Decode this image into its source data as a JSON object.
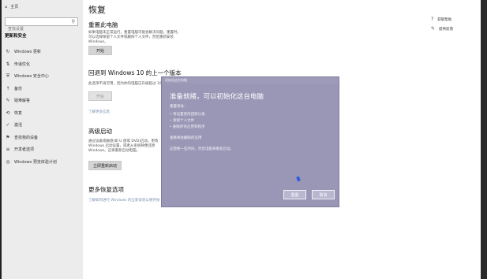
{
  "sidebar": {
    "home_label": "主页",
    "search_placeholder": "查找设置",
    "section_title": "更新和安全",
    "items": [
      {
        "label": "Windows 更新",
        "icon": "sync-icon"
      },
      {
        "label": "传递优化",
        "icon": "delivery-icon"
      },
      {
        "label": "Windows 安全中心",
        "icon": "shield-icon"
      },
      {
        "label": "备份",
        "icon": "backup-icon"
      },
      {
        "label": "疑难解答",
        "icon": "wrench-icon"
      },
      {
        "label": "恢复",
        "icon": "recovery-icon"
      },
      {
        "label": "激活",
        "icon": "check-circle-icon"
      },
      {
        "label": "查找我的设备",
        "icon": "locate-icon"
      },
      {
        "label": "开发者选项",
        "icon": "developer-icon"
      },
      {
        "label": "Windows 预览体验计划",
        "icon": "insider-icon"
      }
    ]
  },
  "main": {
    "title": "恢复",
    "reset": {
      "heading": "重置此电脑",
      "desc": "如果电脑未正常运行，重置电脑可能会解决问题。重置时，可以选择保留个人文件或删除个人文件，然后重新安装 Windows。",
      "button": "开始"
    },
    "rollback": {
      "heading": "回退到 Windows 10 的上一个版本",
      "desc": "此选项不再可用，因为你的电脑已升级超过 10 天。",
      "button": "开始",
      "link": "了解更多信息"
    },
    "advanced": {
      "heading": "高级启动",
      "desc": "通过设备或磁盘(如 U 盘或 DVD)启动，更改 Windows 启动设置，或者从系统映像还原 Windows。这将重新启动电脑。",
      "button": "立即重新启动"
    },
    "more": {
      "heading": "更多恢复选项",
      "link": "了解如何进行 Windows 的全新安装以便开始"
    }
  },
  "right_links": [
    {
      "label": "获取帮助",
      "icon": "help-icon"
    },
    {
      "label": "提供反馈",
      "icon": "feedback-icon"
    }
  ],
  "dialog": {
    "titlebar": "初始化这台电脑",
    "heading": "准备就绪，可以初始化这台电脑",
    "subtitle": "重置将会：",
    "bullets": [
      "• 将设置更改回默认值",
      "• 保留个人文件",
      "• 删除所有应用和程序"
    ],
    "link": "查看将会删除的应用",
    "note": "这需要一些时间，然后电脑将重新启动。",
    "reset_button": "重置",
    "cancel_button": "取消"
  }
}
